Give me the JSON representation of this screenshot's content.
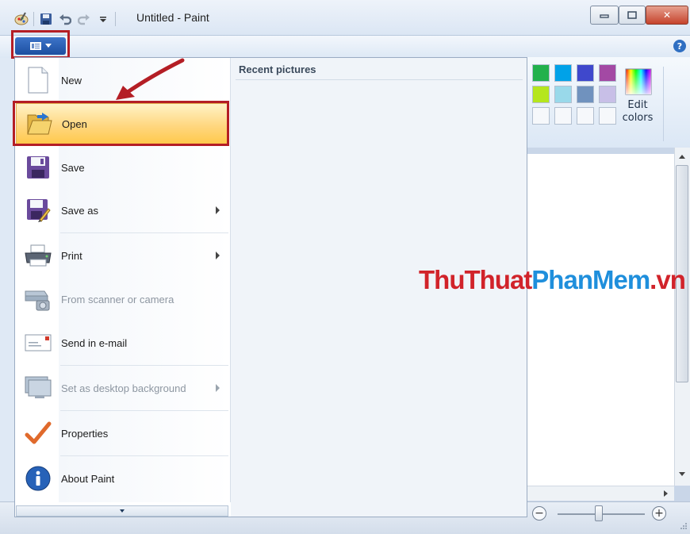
{
  "window": {
    "title": "Untitled - Paint",
    "close_glyph": "✕",
    "minimize_glyph": "▭",
    "maximize_glyph": "□"
  },
  "quick_access": {
    "icons": [
      "paint-icon",
      "save-icon",
      "undo-icon",
      "redo-icon",
      "customize-qat-icon"
    ]
  },
  "help": {
    "glyph": "?"
  },
  "app_menu": {
    "items": [
      {
        "label": "New",
        "icon": "new-document-icon",
        "enabled": true,
        "submenu": false
      },
      {
        "label": "Open",
        "icon": "open-folder-icon",
        "enabled": true,
        "submenu": false,
        "highlighted": true
      },
      {
        "label": "Save",
        "icon": "save-floppy-icon",
        "enabled": true,
        "submenu": false
      },
      {
        "label": "Save as",
        "icon": "save-as-icon",
        "enabled": true,
        "submenu": true
      },
      {
        "label": "Print",
        "icon": "printer-icon",
        "enabled": true,
        "submenu": true
      },
      {
        "label": "From scanner or camera",
        "icon": "scanner-icon",
        "enabled": false,
        "submenu": false
      },
      {
        "label": "Send in e-mail",
        "icon": "email-icon",
        "enabled": true,
        "submenu": false
      },
      {
        "label": "Set as desktop background",
        "icon": "desktop-background-icon",
        "enabled": false,
        "submenu": true
      },
      {
        "label": "Properties",
        "icon": "checkmark-icon",
        "enabled": true,
        "submenu": false
      },
      {
        "label": "About Paint",
        "icon": "info-icon",
        "enabled": true,
        "submenu": false
      }
    ],
    "recent_title": "Recent pictures"
  },
  "colors": {
    "row1": [
      "#22b14c",
      "#00a2e8",
      "#3f48cc",
      "#a349a4"
    ],
    "row2": [
      "#b5e61d",
      "#99d9ea",
      "#7092be",
      "#c8bfe7"
    ],
    "edit_colors_label": "Edit\ncolors"
  },
  "status": {
    "zoom_out": "−",
    "zoom_in": "+",
    "zoom_level_fraction": 0.47
  },
  "watermark": {
    "part1": "ThuThuat",
    "part2": "PhanMem",
    "part3": ".vn"
  },
  "accent": {
    "highlight_border": "#b41e25",
    "arrow": "#b41e25"
  }
}
